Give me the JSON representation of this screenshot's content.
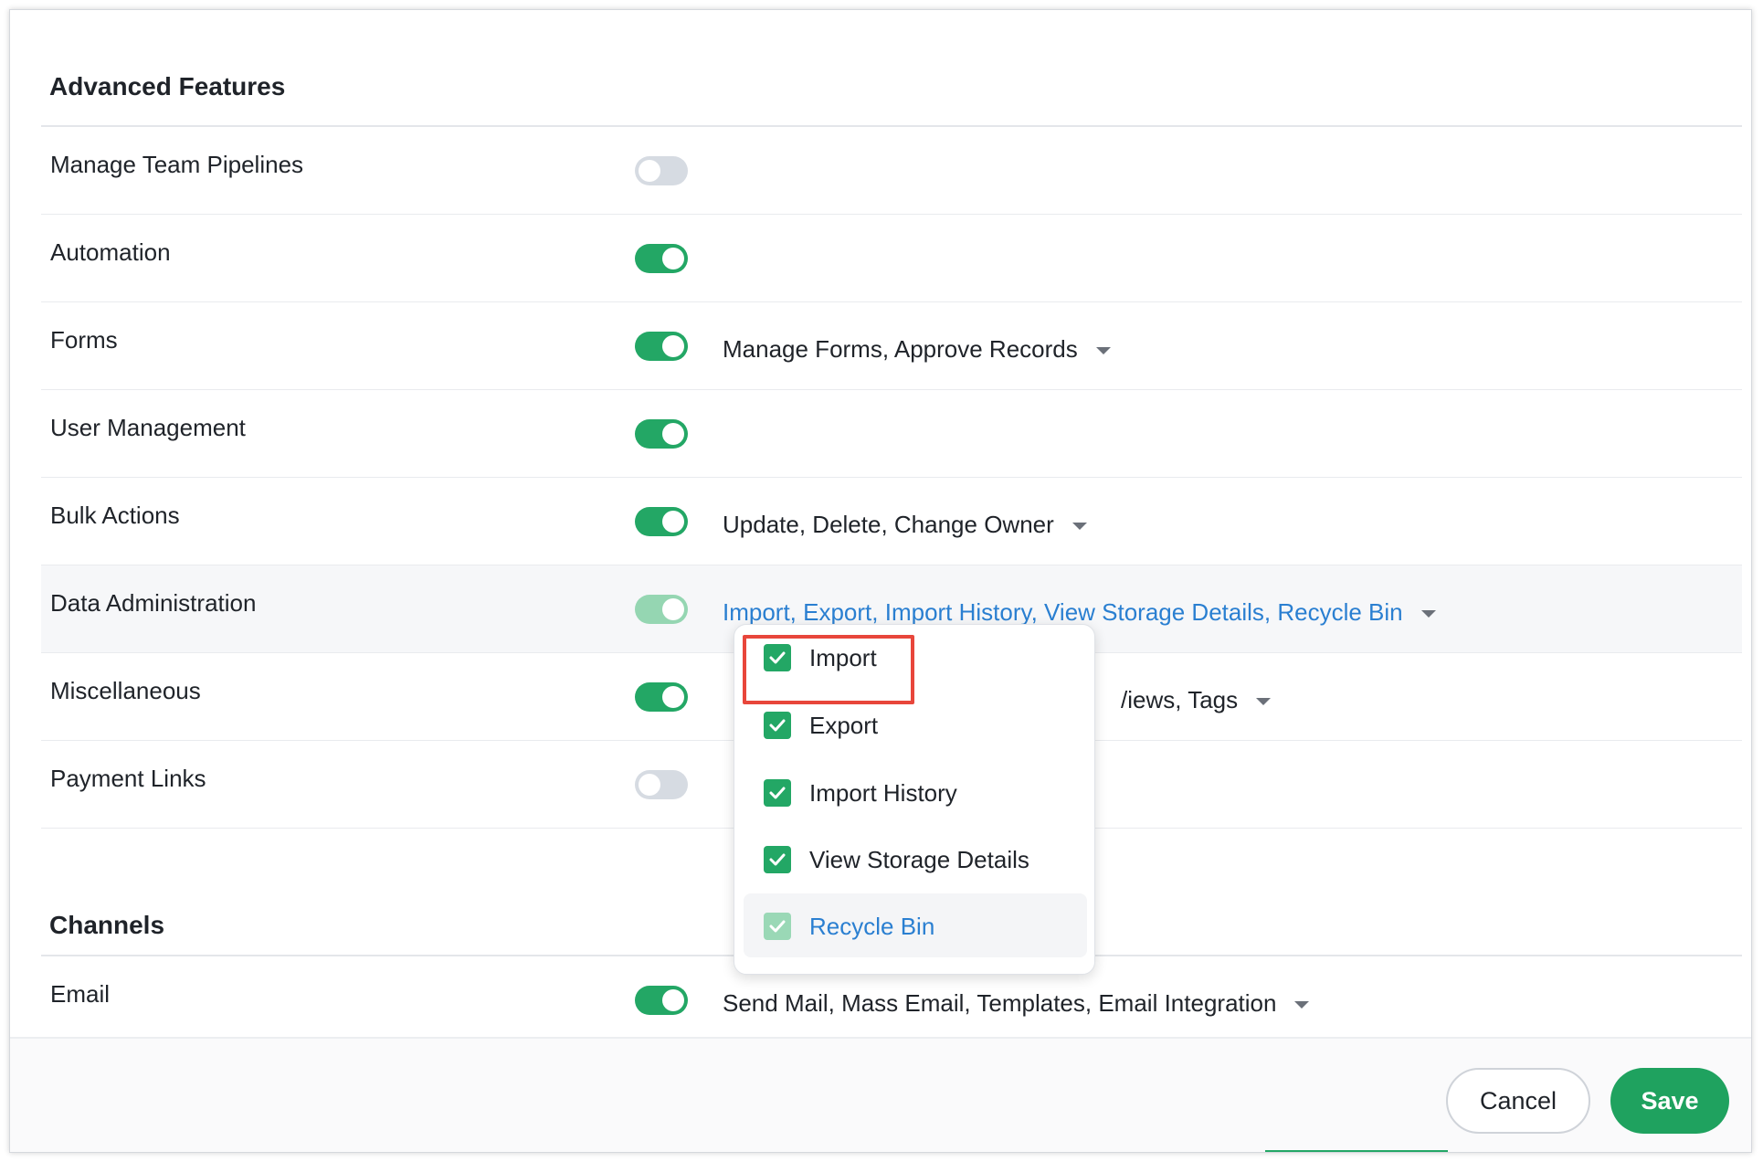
{
  "sections": {
    "advanced_title": "Advanced Features",
    "channels_title": "Channels"
  },
  "rows": [
    {
      "label": "Manage Team Pipelines",
      "toggle": "off",
      "perm": ""
    },
    {
      "label": "Automation",
      "toggle": "on",
      "perm": ""
    },
    {
      "label": "Forms",
      "toggle": "on",
      "perm": "Manage Forms, Approve Records"
    },
    {
      "label": "User Management",
      "toggle": "on",
      "perm": ""
    },
    {
      "label": "Bulk Actions",
      "toggle": "on",
      "perm": "Update, Delete, Change Owner"
    },
    {
      "label": "Data Administration",
      "toggle": "on-disabled",
      "perm": "Import, Export, Import History, View Storage Details, Recycle Bin"
    },
    {
      "label": "Miscellaneous",
      "toggle": "on",
      "perm": "/iews, Tags"
    },
    {
      "label": "Payment Links",
      "toggle": "off",
      "perm": ""
    }
  ],
  "email_row": {
    "label": "Email",
    "toggle": "on",
    "perm": "Send Mail, Mass Email, Templates, Email Integration"
  },
  "dropdown": {
    "items": [
      {
        "label": "Import",
        "checked": true
      },
      {
        "label": "Export",
        "checked": true
      },
      {
        "label": "Import History",
        "checked": true
      },
      {
        "label": "View Storage Details",
        "checked": true
      },
      {
        "label": "Recycle Bin",
        "checked": true,
        "state": "disabled"
      }
    ]
  },
  "footer": {
    "cancel_label": "Cancel",
    "save_label": "Save"
  },
  "colors": {
    "accent": "#23a765",
    "link": "#2a7fd1",
    "annotation": "#e8463b"
  },
  "icons": {
    "checkbox": "check-icon",
    "dropdown": "caret-down-icon"
  }
}
